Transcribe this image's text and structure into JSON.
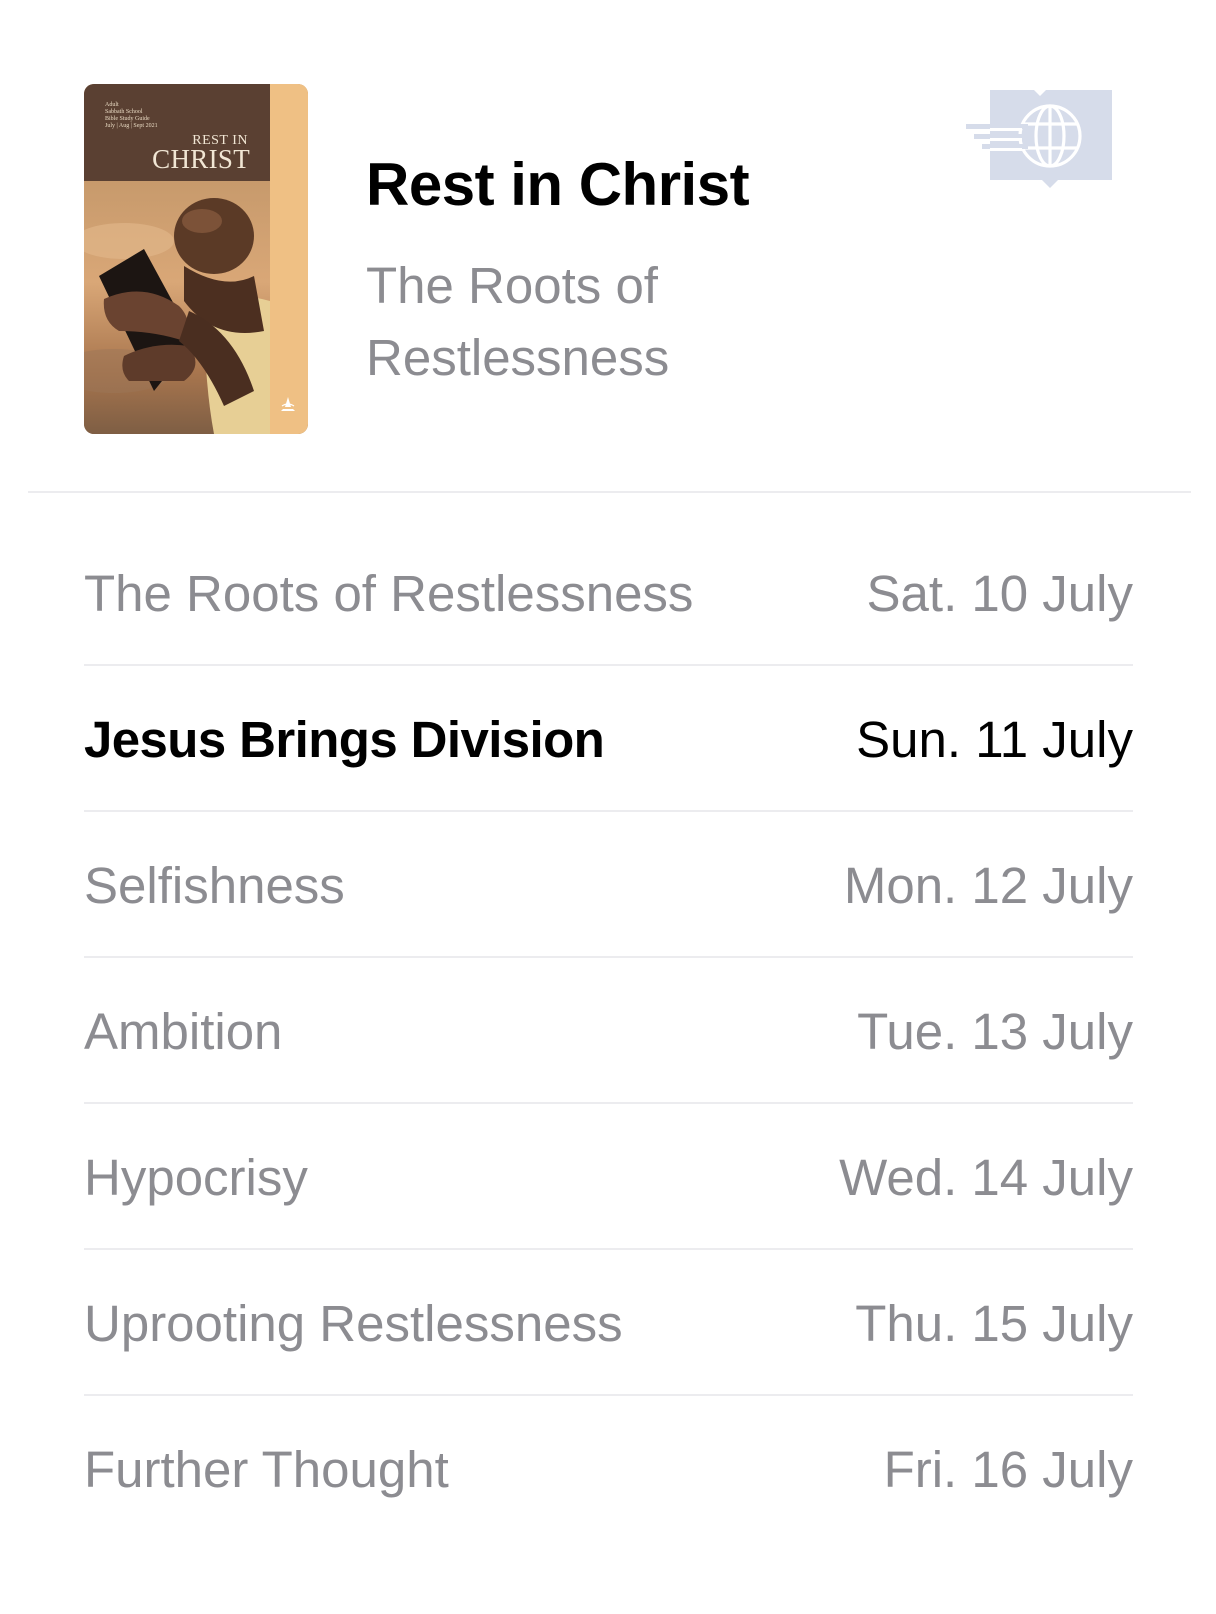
{
  "header": {
    "cover": {
      "small_text": "Adult\nSabbath School\nBible Study Guide\nJuly | Aug | Sept 2021",
      "title_line1": "REST IN",
      "title_line2": "CHRIST"
    },
    "title": "Rest in Christ",
    "subtitle": "The Roots of Restlessness",
    "brand_icon": "globe-book-icon"
  },
  "lessons": [
    {
      "title": "The Roots of Restlessness",
      "date": "Sat. 10 July",
      "active": false
    },
    {
      "title": "Jesus Brings Division",
      "date": "Sun. 11 July",
      "active": true
    },
    {
      "title": "Selfishness",
      "date": "Mon. 12 July",
      "active": false
    },
    {
      "title": "Ambition",
      "date": "Tue. 13 July",
      "active": false
    },
    {
      "title": "Hypocrisy",
      "date": "Wed. 14 July",
      "active": false
    },
    {
      "title": "Uprooting Restlessness",
      "date": "Thu. 15 July",
      "active": false
    },
    {
      "title": "Further Thought",
      "date": "Fri. 16 July",
      "active": false
    }
  ],
  "colors": {
    "inactive_text": "#8c8c91",
    "active_text": "#000000",
    "divider": "#ececef",
    "cover_stripe": "#efc084",
    "brand_logo": "#d6dcea"
  }
}
